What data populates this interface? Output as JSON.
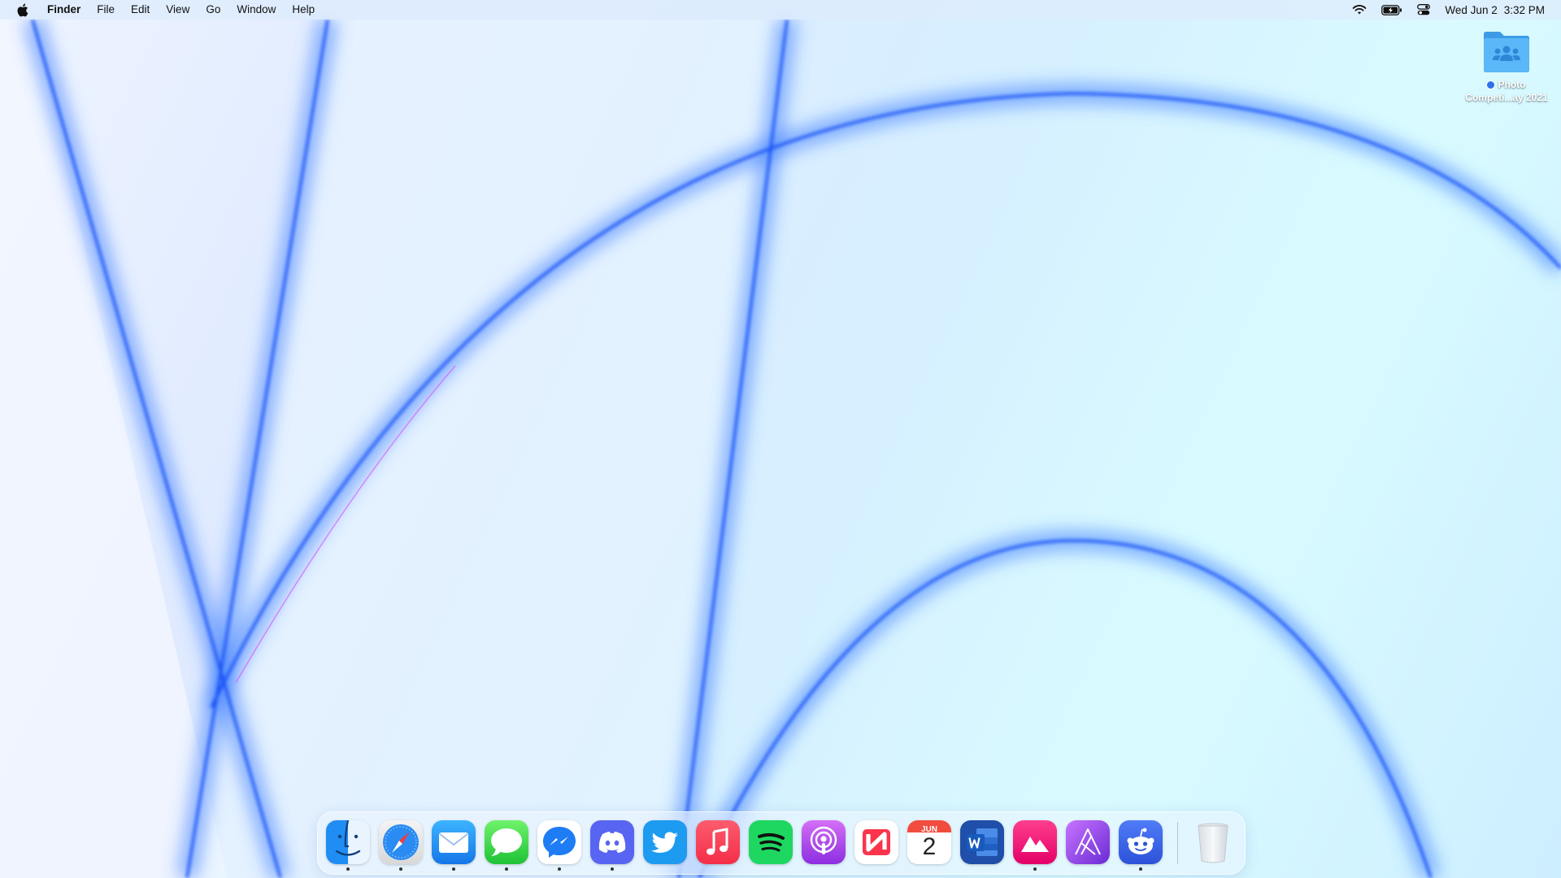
{
  "menubar": {
    "app_name": "Finder",
    "menus": [
      "File",
      "Edit",
      "View",
      "Go",
      "Window",
      "Help"
    ],
    "status": {
      "wifi_icon": "wifi-icon",
      "battery_icon": "battery-charging-icon",
      "control_center_icon": "control-center-icon"
    },
    "date": "Wed Jun 2",
    "time": "3:32 PM"
  },
  "desktop": {
    "icons": [
      {
        "label_line1": "Photo",
        "label_line2": "Competi...ay 2021",
        "tag_color": "#2f6fea",
        "icon": "shared-folder-icon"
      }
    ]
  },
  "dock": {
    "apps": [
      {
        "name": "Finder",
        "icon": "finder-icon",
        "running": true
      },
      {
        "name": "Safari",
        "icon": "safari-icon",
        "running": true
      },
      {
        "name": "Mail",
        "icon": "mail-icon",
        "running": true
      },
      {
        "name": "Messages",
        "icon": "messages-icon",
        "running": true
      },
      {
        "name": "Messenger",
        "icon": "messenger-icon",
        "running": true
      },
      {
        "name": "Discord",
        "icon": "discord-icon",
        "running": true
      },
      {
        "name": "Twitter",
        "icon": "twitter-icon",
        "running": false
      },
      {
        "name": "Music",
        "icon": "music-icon",
        "running": false
      },
      {
        "name": "Spotify",
        "icon": "spotify-icon",
        "running": false
      },
      {
        "name": "Podcasts",
        "icon": "podcasts-icon",
        "running": false
      },
      {
        "name": "News",
        "icon": "news-icon",
        "running": false
      },
      {
        "name": "Calendar",
        "icon": "calendar-icon",
        "running": false,
        "month": "JUN",
        "day": "2"
      },
      {
        "name": "Microsoft Word",
        "icon": "word-icon",
        "running": false
      },
      {
        "name": "Pixelmator",
        "icon": "photo-editor-icon",
        "running": true
      },
      {
        "name": "Affinity Photo",
        "icon": "affinity-icon",
        "running": false
      },
      {
        "name": "Reddit",
        "icon": "reddit-icon",
        "running": true
      },
      {
        "name": "Trash",
        "icon": "trash-icon",
        "running": false
      }
    ]
  },
  "colors": {
    "accent_blue": "#1b5cff",
    "wallpaper_light": "#e6f4ff"
  }
}
